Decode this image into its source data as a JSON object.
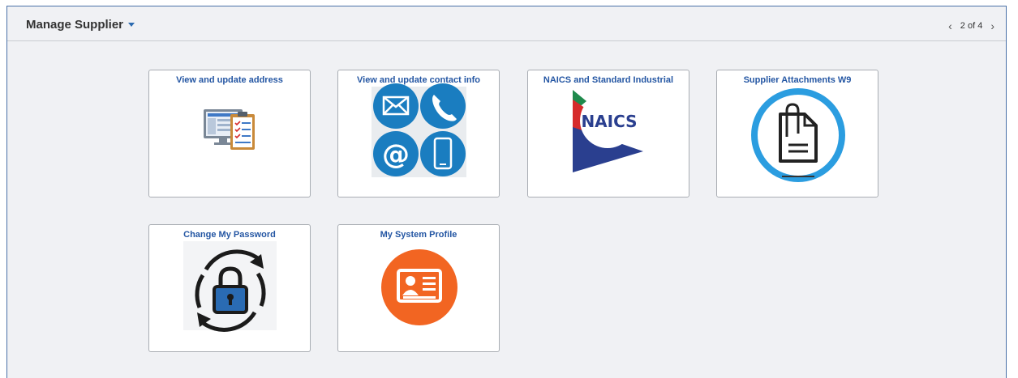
{
  "header": {
    "title": "Manage Supplier",
    "pager_text": "2 of 4",
    "prev_icon": "chevron-left-icon",
    "next_icon": "chevron-right-icon"
  },
  "tiles": [
    {
      "label": "View and update address",
      "icon": "address-form-icon"
    },
    {
      "label": "View and update contact info",
      "icon": "contact-methods-icon"
    },
    {
      "label": "NAICS and Standard Industrial",
      "icon": "naics-logo",
      "logo_text": "NAICS"
    },
    {
      "label": "Supplier Attachments W9",
      "icon": "attachment-document-icon"
    },
    {
      "label": "Change My Password",
      "icon": "password-lock-icon"
    },
    {
      "label": "My System Profile",
      "icon": "profile-card-icon"
    }
  ],
  "colors": {
    "tile_title": "#2456a3",
    "contact_blue": "#1a7dc0",
    "attachment_ring": "#2b9de0",
    "profile_orange": "#f26522",
    "naics_red": "#d62b2b",
    "naics_blue": "#2a3f8f",
    "naics_green": "#1f8a4c"
  }
}
